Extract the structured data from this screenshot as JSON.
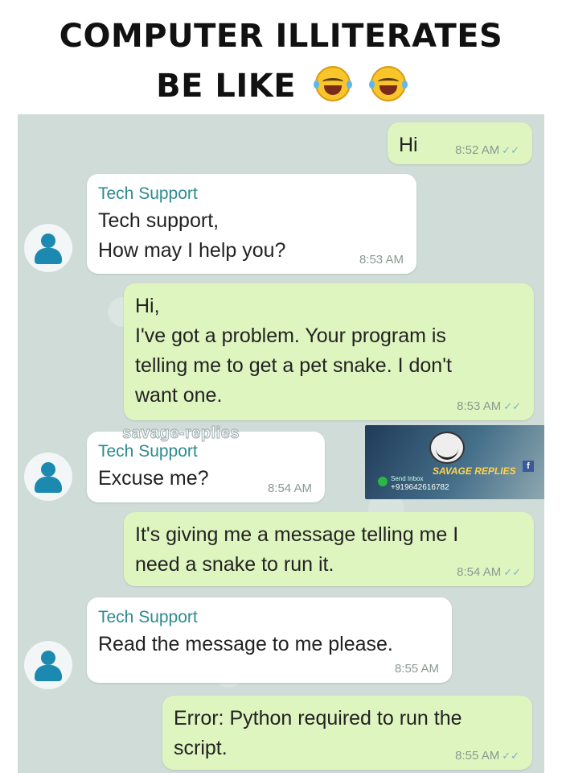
{
  "header": {
    "line1": "COMPUTER ILLITERATES",
    "line2": "BE LIKE"
  },
  "watermark": "savage-replies",
  "ad": {
    "brand": "SAVAGE REPLIES",
    "small": "Send Inbox",
    "phone": "+919642616782",
    "fb": "f"
  },
  "messages": [
    {
      "side": "out",
      "text": "Hi",
      "time": "8:52 AM"
    },
    {
      "side": "in",
      "sender": "Tech Support",
      "lines": [
        "Tech support,",
        "How may I help you?"
      ],
      "time": "8:53 AM"
    },
    {
      "side": "out",
      "lines": [
        "Hi,",
        "I've got a problem. Your program is",
        "telling me to get a pet snake. I don't",
        "want one."
      ],
      "time": "8:53 AM"
    },
    {
      "side": "in",
      "sender": "Tech Support",
      "lines": [
        "Excuse me?"
      ],
      "time": "8:54 AM"
    },
    {
      "side": "out",
      "lines": [
        "It's giving me a message telling me I",
        "need a snake to run it."
      ],
      "time": "8:54 AM"
    },
    {
      "side": "in",
      "sender": "Tech Support",
      "lines": [
        "Read the message to me please."
      ],
      "time": "8:55 AM"
    },
    {
      "side": "out",
      "lines": [
        "Error: Python required to run the",
        "script."
      ],
      "time": "8:55 AM"
    }
  ]
}
